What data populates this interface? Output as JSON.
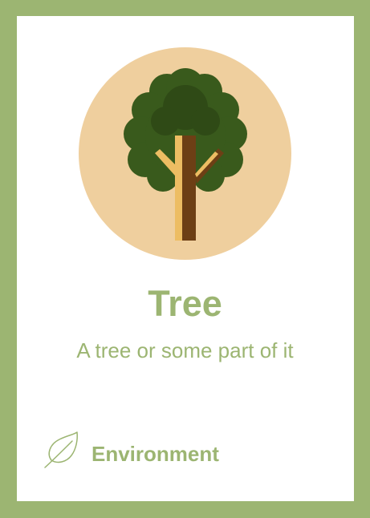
{
  "card": {
    "title": "Tree",
    "description": "A tree or some part of it",
    "category": "Environment",
    "illustration_icon": "tree-icon",
    "category_icon": "leaf-icon"
  },
  "colors": {
    "frame": "#9cb572",
    "text": "#9cb572",
    "badge_background": "#efcf9e",
    "foliage": "#395a1c",
    "trunk": "#6d3f15",
    "trunk_highlight": "#edbd63"
  }
}
